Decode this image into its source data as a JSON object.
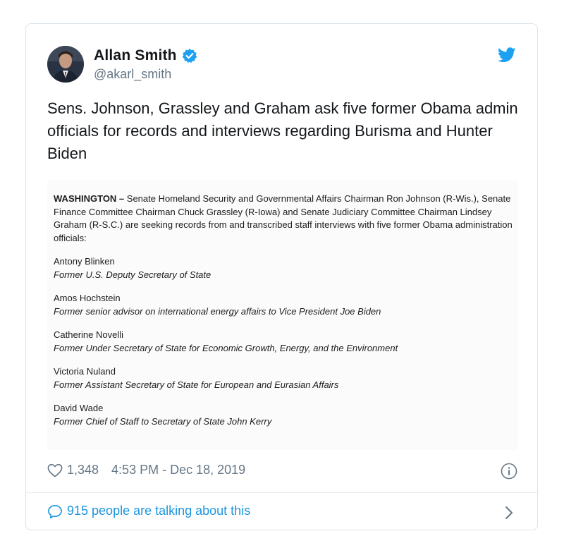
{
  "author": {
    "display_name": "Allan Smith",
    "handle": "@akarl_smith"
  },
  "tweet_text": "Sens. Johnson, Grassley and Graham ask five former Obama admin officials for records and interviews regarding Burisma and Hunter Biden",
  "document": {
    "dateline": "WASHINGTON –",
    "intro": " Senate Homeland Security and Governmental Affairs Chairman Ron Johnson (R-Wis.), Senate Finance Committee Chairman Chuck Grassley (R-Iowa) and Senate Judiciary Committee Chairman Lindsey Graham (R-S.C.) are seeking records from and transcribed staff interviews with five former Obama administration officials:",
    "officials": [
      {
        "name": "Antony Blinken",
        "role": "Former U.S. Deputy Secretary of State"
      },
      {
        "name": "Amos Hochstein",
        "role": "Former senior advisor on international energy affairs to Vice President Joe Biden"
      },
      {
        "name": "Catherine Novelli",
        "role": "Former Under Secretary of State for Economic Growth, Energy, and the Environment"
      },
      {
        "name": "Victoria Nuland",
        "role": "Former Assistant Secretary of State for European and Eurasian Affairs"
      },
      {
        "name": "David Wade",
        "role": "Former Chief of Staff to Secretary of State John Kerry"
      }
    ]
  },
  "meta": {
    "likes": "1,348",
    "timestamp": "4:53 PM - Dec 18, 2019"
  },
  "footer": {
    "talking": "915 people are talking about this"
  },
  "colors": {
    "accent": "#1b95e0",
    "twitter_blue": "#1da1f2",
    "text": "#14171a",
    "secondary": "#657786"
  },
  "icons": [
    "verified-badge-icon",
    "twitter-bird-icon",
    "heart-icon",
    "info-icon",
    "speech-bubble-icon",
    "chevron-right-icon"
  ]
}
